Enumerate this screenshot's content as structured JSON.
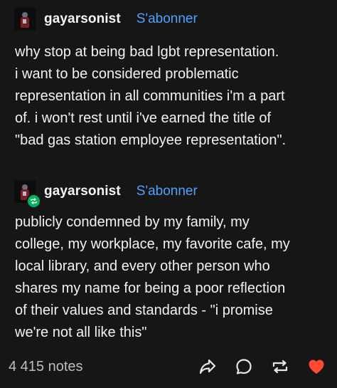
{
  "posts": [
    {
      "username": "gayarsonist",
      "follow_label": "S'abonner",
      "body": "why stop at being bad lgbt representation.\ni want to be considered problematic\nrepresentation in all communities i'm a part\nof. i won't rest until i've earned the title of\n\"bad gas station employee representation\"."
    },
    {
      "username": "gayarsonist",
      "follow_label": "S'abonner",
      "reblogged": true,
      "body": "publicly condemned by my family, my\ncollege, my workplace, my favorite cafe, my\nlocal library, and every other person who\nshares my name for being a poor reflection\nof their values and standards - \"i promise\nwe're not all like this\""
    }
  ],
  "footer": {
    "notes": "4 415 notes",
    "actions": [
      "share-icon",
      "reply-icon",
      "reblog-icon",
      "like-icon"
    ]
  },
  "colors": {
    "background": "#161616",
    "text": "#f2f2f2",
    "follow_link": "#4da3ff",
    "reblog_badge": "#00b35c",
    "like": "#ff4930",
    "notes": "#bdbdbd"
  }
}
